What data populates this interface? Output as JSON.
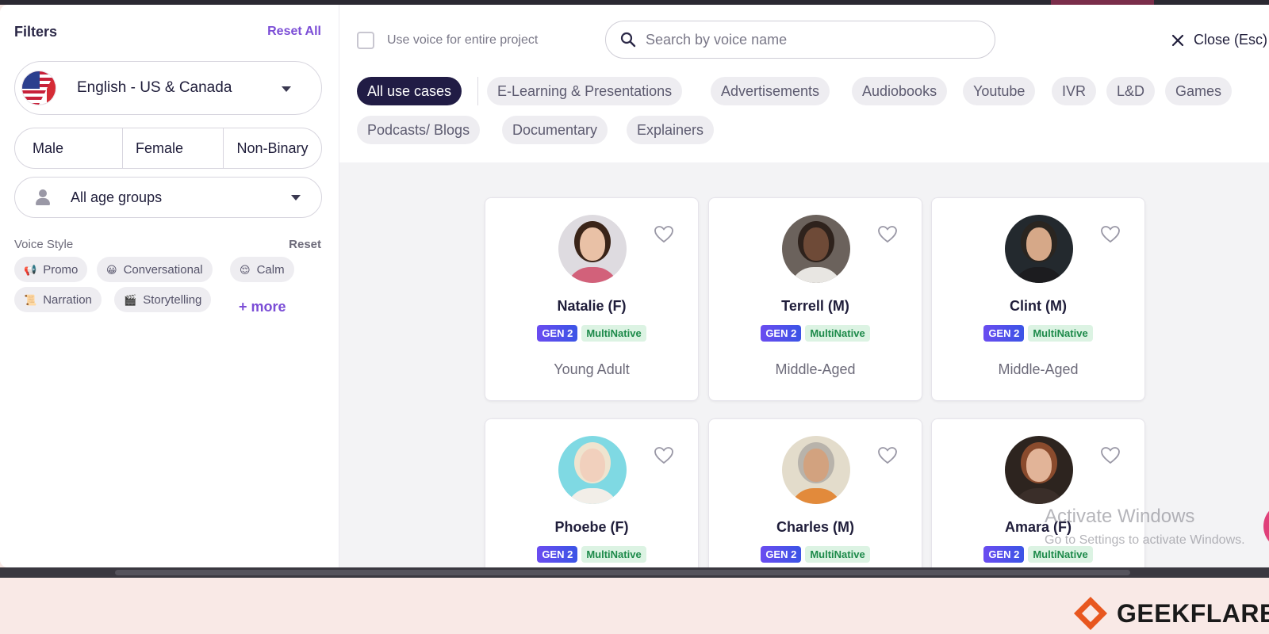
{
  "filters": {
    "title": "Filters",
    "reset_all": "Reset All",
    "language": "English - US & Canada",
    "genders": [
      "Male",
      "Female",
      "Non-Binary"
    ],
    "age_group": "All age groups",
    "voice_style": {
      "title": "Voice Style",
      "reset": "Reset",
      "chips": [
        {
          "emoji": "📢",
          "label": "Promo"
        },
        {
          "emoji": "😀",
          "label": "Conversational"
        },
        {
          "emoji": "😌",
          "label": "Calm"
        },
        {
          "emoji": "📜",
          "label": "Narration"
        },
        {
          "emoji": "🎬",
          "label": "Storytelling"
        }
      ],
      "more": "+ more"
    }
  },
  "toolbar": {
    "use_voice_label": "Use voice for entire project",
    "use_voice_checked": false,
    "search_placeholder": "Search by voice name",
    "close_label": "Close (Esc)"
  },
  "use_cases": {
    "active": "All use cases",
    "items": [
      "All use cases",
      "E-Learning & Presentations",
      "Advertisements",
      "Audiobooks",
      "Youtube",
      "IVR",
      "L&D",
      "Games",
      "Podcasts/ Blogs",
      "Documentary",
      "Explainers"
    ]
  },
  "voices": [
    {
      "name": "Natalie (F)",
      "gen": "GEN 2",
      "tag": "MultiNative",
      "age": "Young Adult",
      "avatar_bg": "#dedbe0",
      "hair": "#3a2418",
      "skin": "#e9c1a6",
      "shirt": "#d2617a"
    },
    {
      "name": "Terrell (M)",
      "gen": "GEN 2",
      "tag": "MultiNative",
      "age": "Middle-Aged",
      "avatar_bg": "#6b625c",
      "hair": "#2e221c",
      "skin": "#6e4a37",
      "shirt": "#e8e6e2"
    },
    {
      "name": "Clint (M)",
      "gen": "GEN 2",
      "tag": "MultiNative",
      "age": "Middle-Aged",
      "avatar_bg": "#23292e",
      "hair": "#2a2520",
      "skin": "#d6a888",
      "shirt": "#1c1c1f"
    },
    {
      "name": "Phoebe (F)",
      "gen": "GEN 2",
      "tag": "MultiNative",
      "age": "",
      "avatar_bg": "#7fd9e3",
      "hair": "#efe4cf",
      "skin": "#f1d0bd",
      "shirt": "#f2eee8"
    },
    {
      "name": "Charles (M)",
      "gen": "GEN 2",
      "tag": "MultiNative",
      "age": "",
      "avatar_bg": "#e3dccb",
      "hair": "#b8b3ab",
      "skin": "#d2a27f",
      "shirt": "#e28a3b"
    },
    {
      "name": "Amara (F)",
      "gen": "GEN 2",
      "tag": "MultiNative",
      "age": "",
      "avatar_bg": "#2d241f",
      "hair": "#8a4b2d",
      "skin": "#e2b498",
      "shirt": "#3a2e29"
    }
  ],
  "watermark": {
    "line1": "Activate Windows",
    "line2": "Go to Settings to activate Windows."
  },
  "brand": {
    "name": "GEEKFLARE",
    "color": "#e8571f"
  }
}
